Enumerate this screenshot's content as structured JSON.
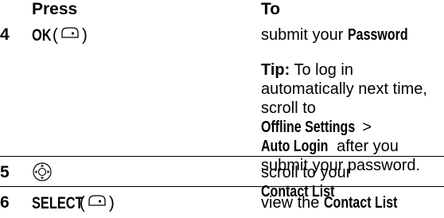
{
  "header": {
    "press": "Press",
    "to": "To"
  },
  "rows": [
    {
      "number": "4",
      "press_key": "OK",
      "press_paren_open": " (",
      "press_paren_close": ")",
      "press_icon": "right-soft-key-icon",
      "to_text": "submit your ",
      "to_term": "Password"
    },
    {
      "tip_label": "Tip:",
      "tip_text_1": " To log in automatically next time, scroll to",
      "tip_term_1": "Offline Settings",
      "tip_sep": " > ",
      "tip_term_2": "Auto Login",
      "tip_text_2": " after you submit your password."
    },
    {
      "number": "5",
      "press_icon": "navigation-key-icon",
      "to_text": "scroll to your ",
      "to_term": "Contact List"
    },
    {
      "number": "6",
      "press_key": "SELECT",
      "press_paren_open": " (",
      "press_paren_close": ")",
      "press_icon": "right-soft-key-icon",
      "to_text": "view the ",
      "to_term": "Contact List"
    }
  ]
}
